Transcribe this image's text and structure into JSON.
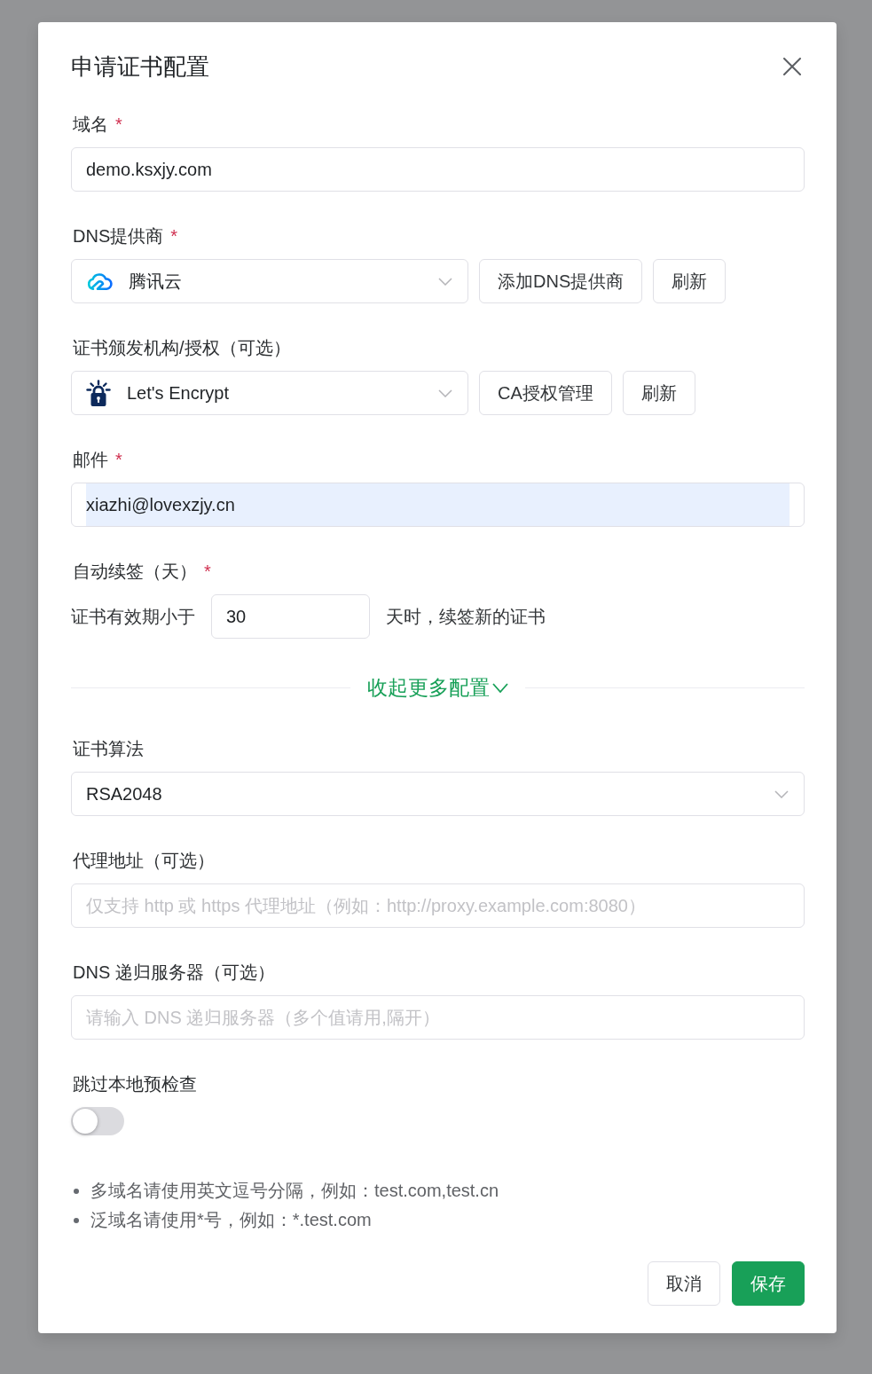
{
  "dialog": {
    "title": "申请证书配置"
  },
  "fields": [
    {
      "kind": "input",
      "label": "域名",
      "required_mark": "*",
      "value": "demo.ksxjy.com",
      "autofilled": false
    },
    {
      "kind": "dns_select",
      "label": "DNS提供商",
      "required_mark": "*",
      "value": "腾讯云",
      "buttons": [
        "添加DNS提供商",
        "刷新"
      ]
    },
    {
      "kind": "ca_select",
      "label": "证书颁发机构/授权（可选）",
      "value": "Let's Encrypt",
      "buttons": [
        "CA授权管理",
        "刷新"
      ]
    },
    {
      "kind": "input",
      "label": "邮件",
      "required_mark": "*",
      "value": "xiazhi@lovexzjy.cn",
      "autofilled": true
    },
    {
      "kind": "renewal",
      "label": "自动续签（天）",
      "required_mark": "*",
      "prefix": "证书有效期小于",
      "value": "30",
      "suffix": "天时，续签新的证书"
    }
  ],
  "more_toggle": {
    "label": "收起更多配置"
  },
  "advanced_fields": [
    {
      "kind": "select",
      "label": "证书算法",
      "value": "RSA2048"
    },
    {
      "kind": "input",
      "label": "代理地址（可选）",
      "placeholder": "仅支持 http 或 https 代理地址（例如：http://proxy.example.com:8080）"
    },
    {
      "kind": "input",
      "label": "DNS 递归服务器（可选）",
      "placeholder": "请输入 DNS 递归服务器（多个值请用,隔开）"
    },
    {
      "kind": "switch",
      "label": "跳过本地预检查",
      "on": false
    }
  ],
  "notes": [
    "多域名请使用英文逗号分隔，例如：test.com,test.cn",
    "泛域名请使用*号，例如：*.test.com"
  ],
  "buttons": [
    {
      "kind": "default",
      "label": "取消"
    },
    {
      "kind": "primary",
      "label": "保存"
    }
  ]
}
